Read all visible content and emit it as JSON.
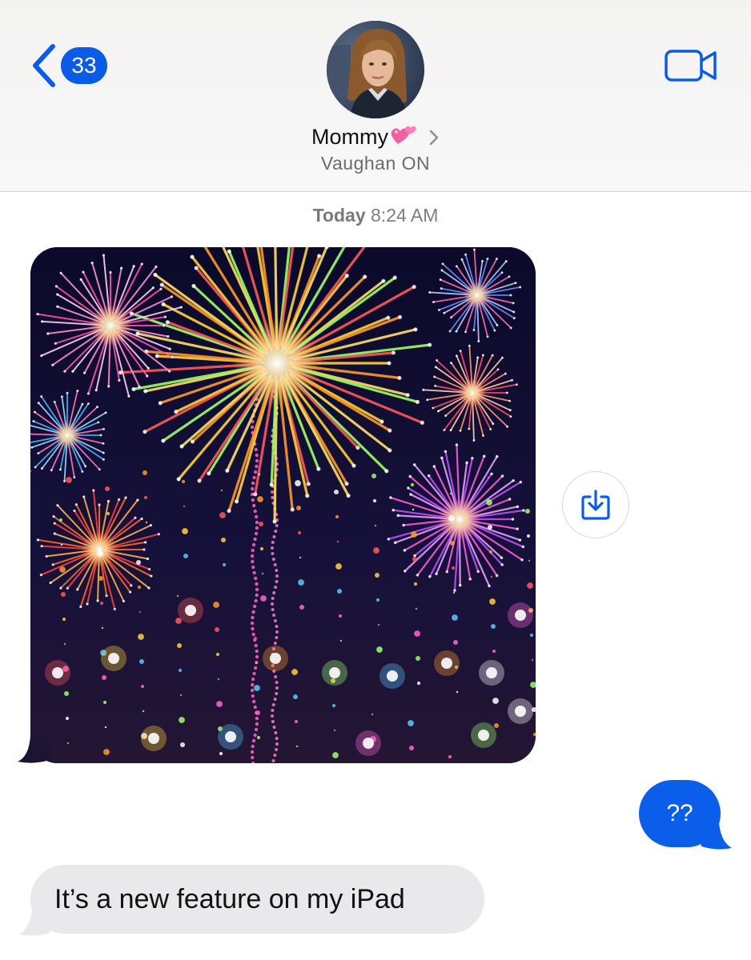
{
  "header": {
    "back_badge_count": "33",
    "contact_name": "Mommy",
    "contact_subtitle": "Vaughan ON",
    "icons": {
      "back": "chevron-left-icon",
      "video": "video-camera-icon",
      "name_emoji": "two-hearts-emoji",
      "details": "chevron-right-icon"
    }
  },
  "conversation": {
    "timestamp_day": "Today",
    "timestamp_time": "8:24 AM",
    "messages": [
      {
        "direction": "incoming",
        "type": "image",
        "content": "fireworks illustration"
      },
      {
        "direction": "outgoing",
        "type": "text",
        "text": "??"
      },
      {
        "direction": "incoming",
        "type": "text",
        "text": "It’s a new feature on my iPad"
      }
    ],
    "save_icon": "save-download-icon"
  },
  "colors": {
    "accent_blue": "#0a5ce6",
    "incoming_bubble": "#e9e9eb",
    "outgoing_bubble": "#0b5ee9",
    "header_bg": "#f5f4f3"
  }
}
